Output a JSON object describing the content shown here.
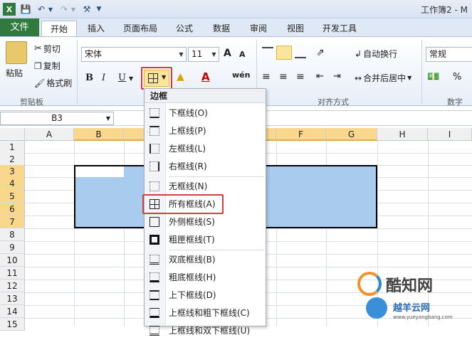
{
  "window": {
    "title": "工作簿2 - M"
  },
  "tabs": {
    "file": "文件",
    "home": "开始",
    "insert": "插入",
    "page_layout": "页面布局",
    "formulas": "公式",
    "data": "数据",
    "review": "审阅",
    "view": "视图",
    "developer": "开发工具"
  },
  "ribbon": {
    "clipboard": {
      "paste": "粘贴",
      "cut": "剪切",
      "copy": "复制",
      "format_painter": "格式刷",
      "group_label": "剪贴板"
    },
    "font": {
      "name": "宋体",
      "size": "11",
      "bold": "B",
      "italic": "I",
      "underline": "U",
      "grow": "A",
      "shrink": "A",
      "phonetic": "wén"
    },
    "alignment": {
      "wrap_text": "自动换行",
      "merge_center": "合并后居中",
      "group_label": "对齐方式"
    },
    "number": {
      "format": "常规",
      "percent": "%",
      "group_label": "数字"
    }
  },
  "formula_bar": {
    "name_box": "B3"
  },
  "columns": [
    "A",
    "B",
    "C",
    "D",
    "E",
    "F",
    "G",
    "H",
    "I"
  ],
  "rows": [
    "1",
    "2",
    "3",
    "4",
    "5",
    "6",
    "7",
    "8",
    "9",
    "10",
    "11",
    "12",
    "13",
    "14",
    "15"
  ],
  "border_menu": {
    "header": "边框",
    "items": [
      "下框线(O)",
      "上框线(P)",
      "左框线(L)",
      "右框线(R)",
      "无框线(N)",
      "所有框线(A)",
      "外侧框线(S)",
      "粗匣框线(T)",
      "双底框线(B)",
      "粗底框线(H)",
      "上下框线(D)",
      "上框线和粗下框线(C)",
      "上框线和双下框线(U)"
    ]
  },
  "watermark": {
    "text1": "酷知网",
    "text2": "越羊云网",
    "url": "www.yueyangbang.com"
  },
  "colors": {
    "file_tab": "#2f7a3c",
    "selection": "#a8cbee",
    "highlight_border": "#d63b40",
    "header_selected": "#f9d88d"
  }
}
